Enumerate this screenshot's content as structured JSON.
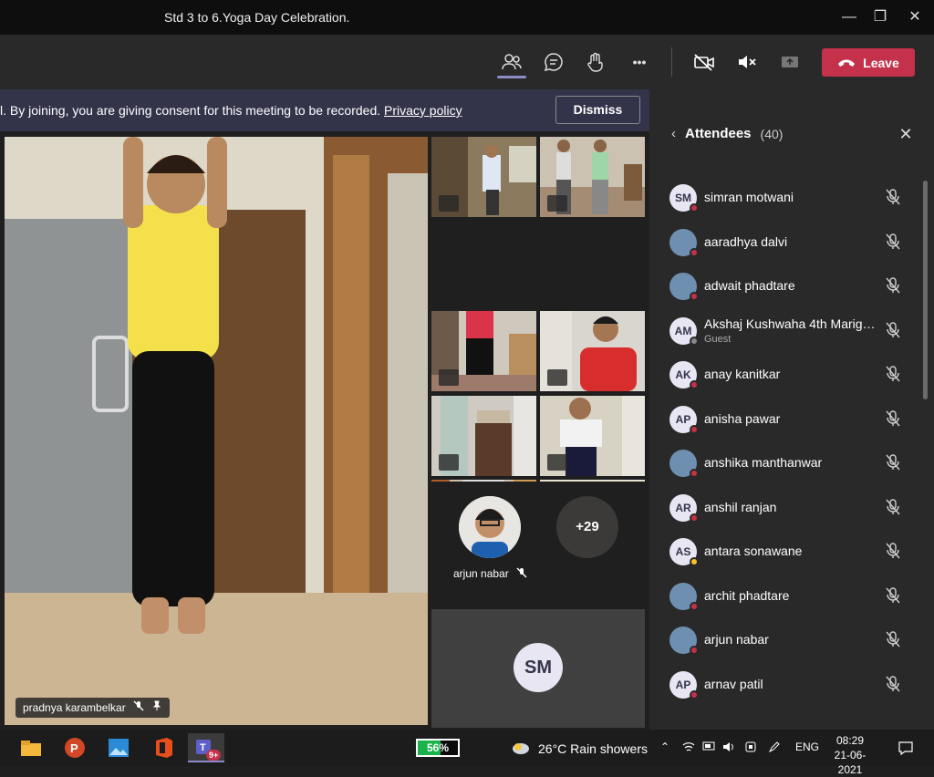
{
  "window": {
    "title": "Std 3 to 6.Yoga Day Celebration.",
    "min": "—",
    "max": "❐",
    "close": "✕"
  },
  "toolbar": {
    "leave_label": "Leave",
    "more": "•••",
    "accent": "#c4314b"
  },
  "banner": {
    "message": "l. By joining, you are giving consent for this meeting to be recorded. ",
    "link": "Privacy policy",
    "dismiss": "Dismiss"
  },
  "stage": {
    "main_name": "pradnya karambelkar",
    "arjun_name": "arjun nabar",
    "overflow": "+29",
    "sm_initials": "SM"
  },
  "panel": {
    "title": "Attendees",
    "count": "(40)",
    "attendees": [
      {
        "initials": "SM",
        "name": "simran motwani",
        "status": "#c4314b"
      },
      {
        "initials": "",
        "name": "aaradhya dalvi",
        "status": "#c4314b"
      },
      {
        "initials": "",
        "name": "adwait phadtare",
        "status": "#c4314b"
      },
      {
        "initials": "AM",
        "name": "Akshaj Kushwaha 4th Marigol...",
        "sub": "Guest",
        "status": "#888888"
      },
      {
        "initials": "AK",
        "name": "anay kanitkar",
        "status": "#c4314b"
      },
      {
        "initials": "AP",
        "name": "anisha pawar",
        "status": "#c4314b"
      },
      {
        "initials": "",
        "name": "anshika manthanwar",
        "status": "#c4314b"
      },
      {
        "initials": "AR",
        "name": "anshil ranjan",
        "status": "#c4314b"
      },
      {
        "initials": "AS",
        "name": "antara sonawane",
        "status": "#f8c12d"
      },
      {
        "initials": "",
        "name": "archit phadtare",
        "status": "#c4314b"
      },
      {
        "initials": "",
        "name": "arjun nabar",
        "status": "#c4314b"
      },
      {
        "initials": "AP",
        "name": "arnav patil",
        "status": "#c4314b"
      }
    ]
  },
  "taskbar": {
    "battery": "56%",
    "battery_level": 0.56,
    "weather": "26°C  Rain showers",
    "lang": "ENG",
    "time": "08:29",
    "date": "21-06-2021",
    "teams_badge": "9+"
  }
}
